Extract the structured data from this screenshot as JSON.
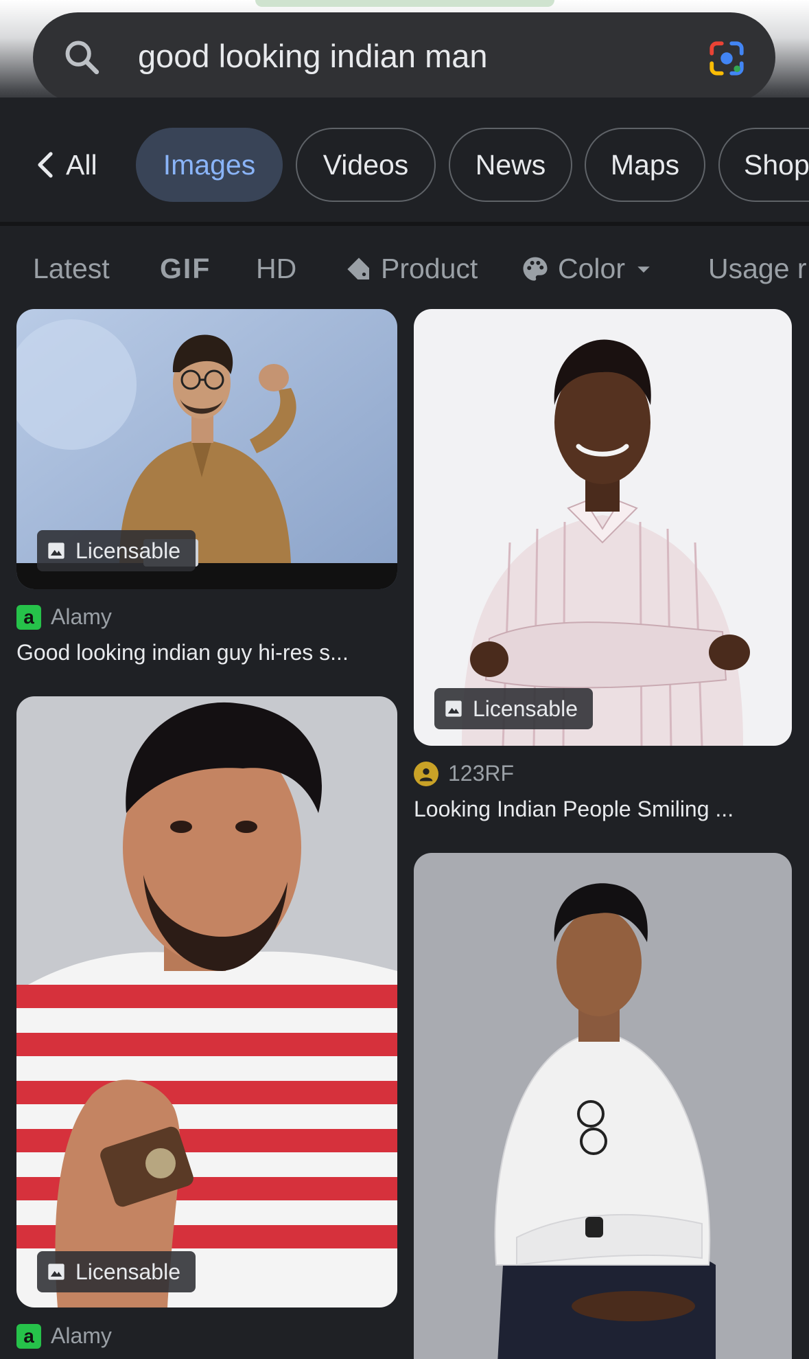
{
  "search": {
    "query": "good looking indian man",
    "search_icon": "search-icon",
    "lens_icon": "google-lens-icon"
  },
  "tabs": [
    {
      "label": "All"
    },
    {
      "label": "Images",
      "active": true
    },
    {
      "label": "Videos"
    },
    {
      "label": "News"
    },
    {
      "label": "Maps"
    },
    {
      "label": "Shop"
    }
  ],
  "filters": [
    {
      "label": "Latest"
    },
    {
      "label": "GIF"
    },
    {
      "label": "HD"
    },
    {
      "label": "Product",
      "icon": "tag-icon"
    },
    {
      "label": "Color",
      "icon": "palette-icon"
    },
    {
      "label": "Usage r"
    }
  ],
  "results": [
    {
      "badge": "Licensable",
      "source": "Alamy",
      "caption": "Good looking indian guy hi-res s..."
    },
    {
      "badge": "Licensable",
      "source": "123RF",
      "caption": "Looking Indian People Smiling ..."
    },
    {
      "badge": "Licensable",
      "source": "Alamy"
    },
    {}
  ],
  "colors": {
    "background": "#1f2125",
    "active_tab_bg": "#394457",
    "active_tab_text": "#8ab4f8",
    "alamy_green": "#26c24a"
  }
}
